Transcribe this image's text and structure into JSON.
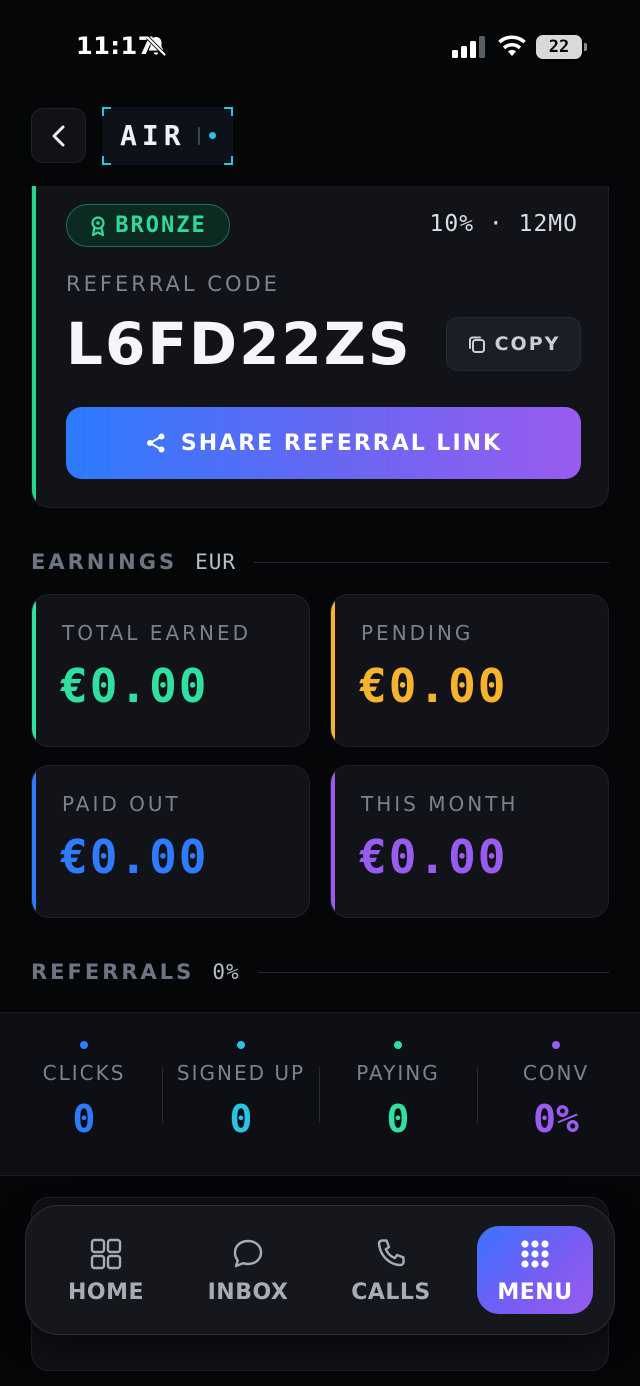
{
  "status_bar": {
    "time": "11:17",
    "battery": "22"
  },
  "header": {
    "logo_text": "AIR"
  },
  "referral": {
    "tier": "BRONZE",
    "commission": "10% · 12MO",
    "code_label": "REFERRAL CODE",
    "code": "L6FD22ZS",
    "copy_label": "COPY",
    "share_label": "SHARE REFERRAL LINK"
  },
  "earnings": {
    "title": "EARNINGS",
    "currency": "EUR",
    "cards": [
      {
        "label": "TOTAL EARNED",
        "value": "€0.00",
        "color": "#2fe0a0"
      },
      {
        "label": "PENDING",
        "value": "€0.00",
        "color": "#f5b32e"
      },
      {
        "label": "PAID OUT",
        "value": "€0.00",
        "color": "#2f7bff"
      },
      {
        "label": "THIS MONTH",
        "value": "€0.00",
        "color": "#9a5cf0"
      }
    ]
  },
  "referrals": {
    "title": "REFERRALS",
    "rate": "0%",
    "stats": [
      {
        "label": "CLICKS",
        "value": "0",
        "color": "#2f7bff"
      },
      {
        "label": "SIGNED UP",
        "value": "0",
        "color": "#27c4e6"
      },
      {
        "label": "PAYING",
        "value": "0",
        "color": "#2fe0a0"
      },
      {
        "label": "CONV",
        "value": "0%",
        "color": "#9a5cf0"
      }
    ]
  },
  "tabbar": {
    "tabs": [
      {
        "label": "HOME",
        "icon": "grid-icon"
      },
      {
        "label": "INBOX",
        "icon": "chat-bubble-icon"
      },
      {
        "label": "CALLS",
        "icon": "phone-icon"
      },
      {
        "label": "MENU",
        "icon": "dots-grid-icon",
        "active": true
      }
    ]
  },
  "colors": {
    "accent_green": "#27d58f",
    "accent_blue": "#2d7bff",
    "accent_purple": "#9a5cf0",
    "accent_cyan": "#27c4e6",
    "accent_amber": "#f5b32e"
  }
}
